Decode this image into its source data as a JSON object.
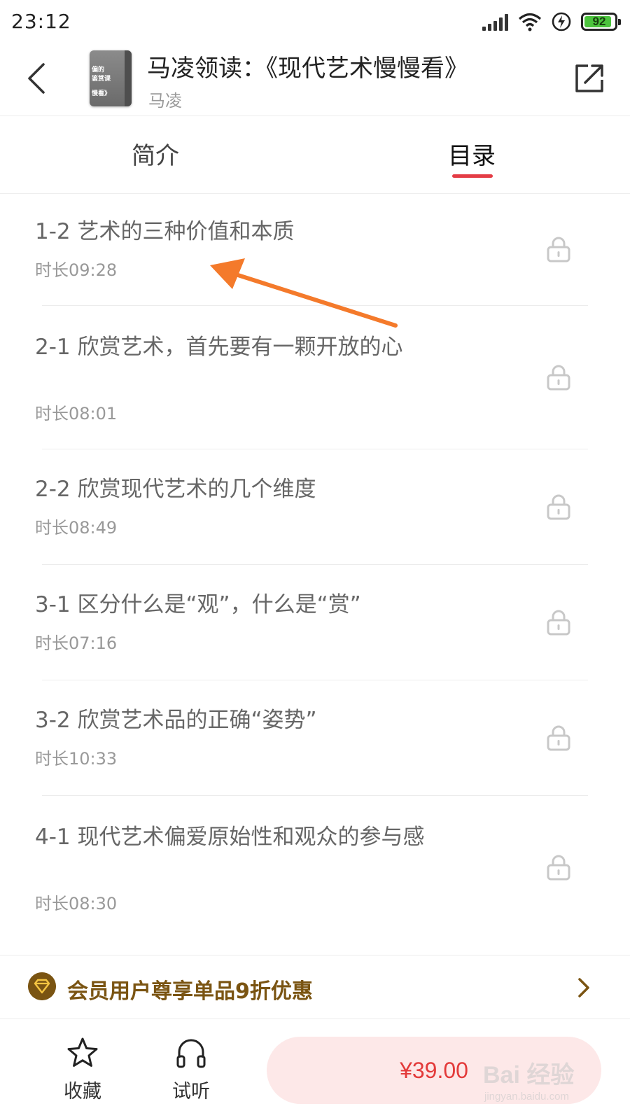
{
  "status_bar": {
    "time": "23:12",
    "battery_level": "92",
    "battery_fraction": 0.92
  },
  "header": {
    "cover_lines": [
      "偏的",
      "鉴赏课",
      "",
      "慢看》"
    ],
    "title": "马凌领读：《现代艺术慢慢看》",
    "author": "马凌",
    "back_icon": "chevron-left-icon",
    "share_icon": "share-external-icon"
  },
  "tabs": [
    {
      "label": "简介",
      "active": false
    },
    {
      "label": "目录",
      "active": true
    }
  ],
  "colors": {
    "accent": "#e43c45",
    "promo": "#7a5412",
    "price": "#e33a3a",
    "buy_bg": "#fde8e8",
    "annotation_arrow": "#f47a2b"
  },
  "chapters": [
    {
      "title": "1-2 艺术的三种价值和本质",
      "duration": "时长09:28",
      "locked": true
    },
    {
      "title": "2-1 欣赏艺术，首先要有一颗开放的心",
      "duration": "时长08:01",
      "locked": true
    },
    {
      "title": "2-2 欣赏现代艺术的几个维度",
      "duration": "时长08:49",
      "locked": true
    },
    {
      "title": "3-1 区分什么是“观”，什么是“赏”",
      "duration": "时长07:16",
      "locked": true
    },
    {
      "title": "3-2 欣赏艺术品的正确“姿势”",
      "duration": "时长10:33",
      "locked": true
    },
    {
      "title": "4-1 现代艺术偏爱原始性和观众的参与感",
      "duration": "时长08:30",
      "locked": true
    }
  ],
  "promo": {
    "text": "会员用户尊享单品9折优惠",
    "icon": "diamond-badge-icon"
  },
  "bottom_bar": {
    "favorite_label": "收藏",
    "favorite_icon": "star-icon",
    "trial_label": "试听",
    "trial_icon": "headphones-icon",
    "price": "¥39.00"
  },
  "watermark": {
    "main": "Bai 经验",
    "sub": "jingyan.baidu.com"
  }
}
